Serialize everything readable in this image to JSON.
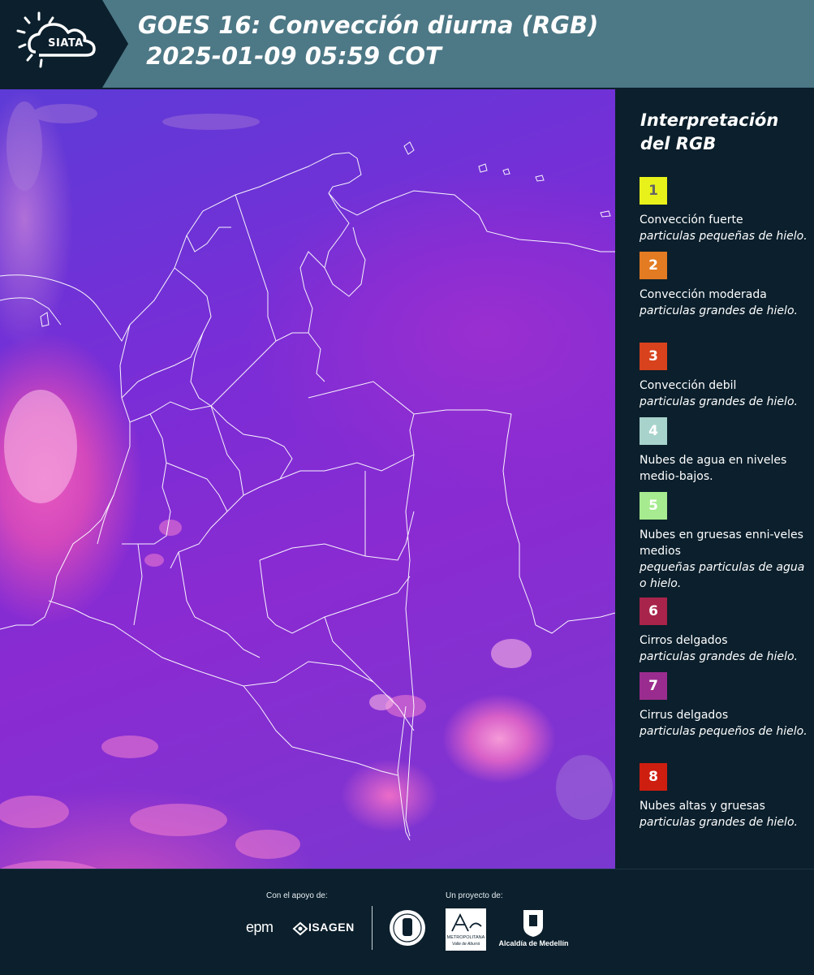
{
  "header": {
    "logo_text": "SIATA",
    "title_line1": "GOES 16: Convección diurna (RGB)",
    "title_line2": " 2025-01-09 05:59 COT",
    "bg_color": "#4d7886"
  },
  "legend": {
    "title": "Interpretación del RGB",
    "items": [
      {
        "num": "1",
        "color": "#e8f21a",
        "num_color": "#666666",
        "label": "Convección fuerte",
        "desc": "particulas pequeñas de hielo."
      },
      {
        "num": "2",
        "color": "#e37b22",
        "num_color": "#ffffff",
        "label": "Convección moderada",
        "desc": "particulas grandes de hielo."
      },
      {
        "num": "3",
        "color": "#d8421c",
        "num_color": "#ffffff",
        "label": "Convección debil",
        "desc": "particulas grandes de hielo."
      },
      {
        "num": "4",
        "color": "#a7d3cc",
        "num_color": "#ffffff",
        "label": "Nubes de agua en niveles medio-bajos.",
        "desc": ""
      },
      {
        "num": "5",
        "color": "#a6eb8f",
        "num_color": "#ffffff",
        "label": "Nubes en gruesas enni-veles medios",
        "desc": "pequeñas particulas de agua o hielo."
      },
      {
        "num": "6",
        "color": "#a8244a",
        "num_color": "#ffffff",
        "label": "Cirros delgados",
        "desc": "particulas grandes de hielo."
      },
      {
        "num": "7",
        "color": "#9b2c8f",
        "num_color": "#ffffff",
        "label": "Cirrus delgados",
        "desc": "particulas pequeños de hielo."
      },
      {
        "num": "8",
        "color": "#ce1e10",
        "num_color": "#ffffff",
        "label": "Nubes altas y gruesas",
        "desc": "particulas grandes de hielo."
      }
    ]
  },
  "footer": {
    "support_label": "Con el apoyo de:",
    "project_label": "Un proyecto de:",
    "sponsors": [
      "epm",
      "ISAGEN"
    ],
    "partners": [
      "METROPOLITANA",
      "Valle de Aburrá",
      "Alcaldía de Medellín"
    ]
  }
}
